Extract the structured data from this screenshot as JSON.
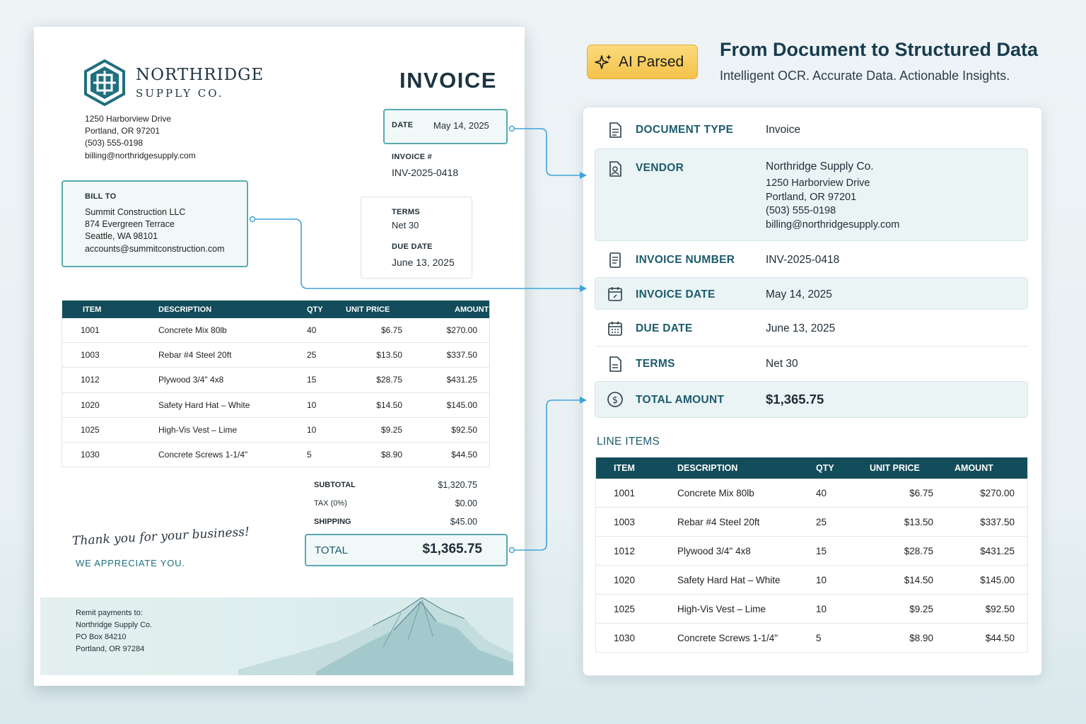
{
  "invoice": {
    "vendor_name_line1": "NORTHRIDGE",
    "vendor_name_line2": "SUPPLY CO.",
    "vendor_address": [
      "1250 Harborview Drive",
      "Portland, OR 97201",
      "(503) 555-0198",
      "billing@northridgesupply.com"
    ],
    "title": "INVOICE",
    "date_label": "DATE",
    "date_value": "May 14, 2025",
    "invoice_no_label": "INVOICE #",
    "invoice_no_value": "INV-2025-0418",
    "bill_to_label": "BILL TO",
    "bill_to_lines": [
      "Summit Construction LLC",
      "874 Evergreen Terrace",
      "Seattle, WA 98101",
      "accounts@summitconstruction.com"
    ],
    "terms_label": "TERMS",
    "terms_value": "Net 30",
    "due_date_label": "DUE DATE",
    "due_date_value": "June 13, 2025",
    "table_headers": [
      "ITEM",
      "DESCRIPTION",
      "QTY",
      "UNIT PRICE",
      "AMOUNT"
    ],
    "line_items": [
      [
        "1001",
        "Concrete Mix 80lb",
        "40",
        "$6.75",
        "$270.00"
      ],
      [
        "1003",
        "Rebar #4 Steel 20ft",
        "25",
        "$13.50",
        "$337.50"
      ],
      [
        "1012",
        "Plywood 3/4\" 4x8",
        "15",
        "$28.75",
        "$431.25"
      ],
      [
        "1020",
        "Safety Hard Hat – White",
        "10",
        "$14.50",
        "$145.00"
      ],
      [
        "1025",
        "High-Vis Vest – Lime",
        "10",
        "$9.25",
        "$92.50"
      ],
      [
        "1030",
        "Concrete Screws 1-1/4\"",
        "5",
        "$8.90",
        "$44.50"
      ]
    ],
    "subtotal_label": "SUBTOTAL",
    "subtotal_value": "$1,320.75",
    "tax_label": "TAX (0%)",
    "tax_value": "$0.00",
    "shipping_label": "SHIPPING",
    "shipping_value": "$45.00",
    "total_label": "TOTAL",
    "total_value": "$1,365.75",
    "thanks": "Thank you for your business!",
    "appreciate": "WE APPRECIATE YOU.",
    "remit_lines": [
      "Remit payments to:",
      "Northridge Supply Co.",
      "PO Box 84210",
      "Portland, OR 97284"
    ]
  },
  "header": {
    "badge": "AI Parsed",
    "title": "From Document to Structured Data",
    "subtitle": "Intelligent OCR. Accurate Data. Actionable Insights."
  },
  "extracted": {
    "document_type_label": "DOCUMENT TYPE",
    "document_type_value": "Invoice",
    "vendor_label": "VENDOR",
    "vendor_name": "Northridge Supply Co.",
    "vendor_lines": [
      "1250 Harborview Drive",
      "Portland, OR 97201",
      "(503) 555-0198",
      "billing@northridgesupply.com"
    ],
    "invoice_number_label": "INVOICE NUMBER",
    "invoice_number_value": "INV-2025-0418",
    "invoice_date_label": "INVOICE DATE",
    "invoice_date_value": "May 14, 2025",
    "due_date_label": "DUE DATE",
    "due_date_value": "June 13, 2025",
    "terms_label": "TERMS",
    "terms_value": "Net 30",
    "total_amount_label": "TOTAL AMOUNT",
    "total_amount_value": "$1,365.75",
    "line_items_title": "LINE ITEMS",
    "table_headers": [
      "ITEM",
      "DESCRIPTION",
      "QTY",
      "UNIT PRICE",
      "AMOUNT"
    ],
    "line_items": [
      [
        "1001",
        "Concrete Mix 80lb",
        "40",
        "$6.75",
        "$270.00"
      ],
      [
        "1003",
        "Rebar #4 Steel 20ft",
        "25",
        "$13.50",
        "$337.50"
      ],
      [
        "1012",
        "Plywood 3/4\" 4x8",
        "15",
        "$28.75",
        "$431.25"
      ],
      [
        "1020",
        "Safety Hard Hat – White",
        "10",
        "$14.50",
        "$145.00"
      ],
      [
        "1025",
        "High-Vis Vest – Lime",
        "10",
        "$9.25",
        "$92.50"
      ],
      [
        "1030",
        "Concrete Screws 1-1/4\"",
        "5",
        "$8.90",
        "$44.50"
      ]
    ]
  },
  "colors": {
    "teal_dark": "#134c5a",
    "teal_accent": "#5aa9ad",
    "connector_blue": "#3ea3d8",
    "badge_gold": "#f4c24a"
  }
}
